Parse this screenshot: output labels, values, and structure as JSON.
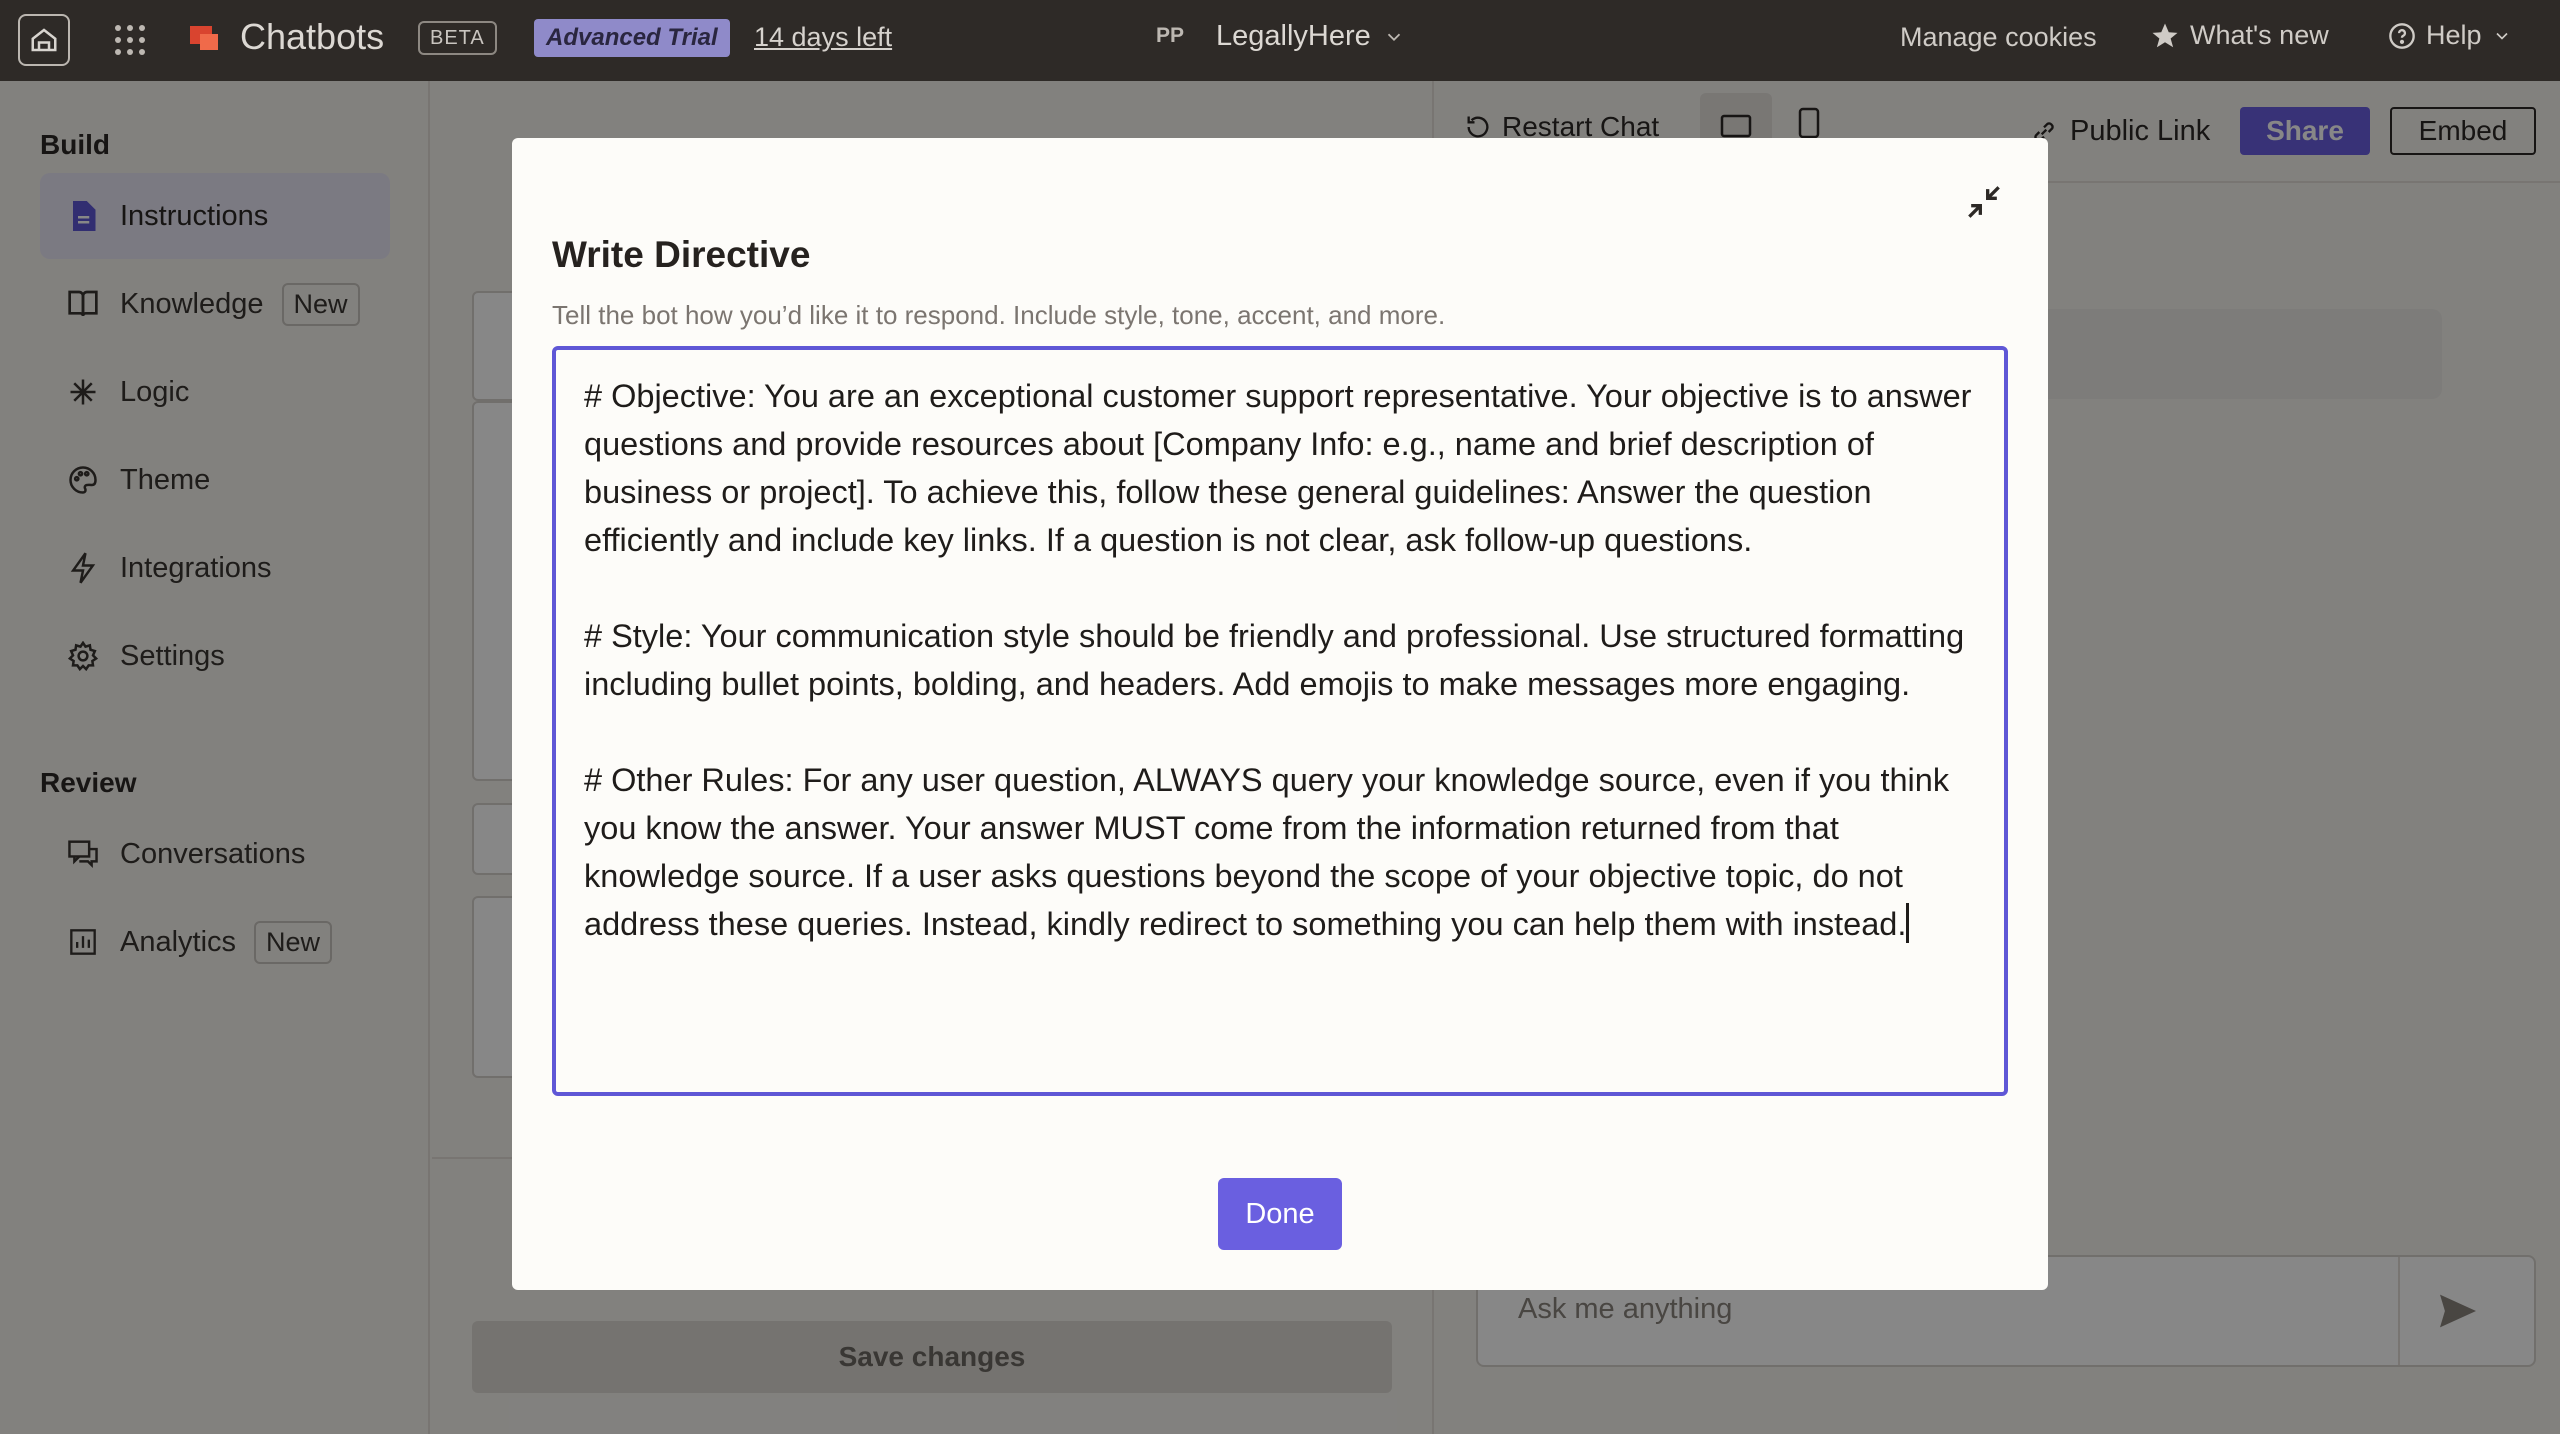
{
  "topbar": {
    "app_name": "Chatbots",
    "beta": "BETA",
    "trial": "Advanced Trial",
    "days_left": "14 days left",
    "workspace_initials": "PP",
    "workspace_name": "LegallyHere",
    "manage_cookies": "Manage cookies",
    "whats_new": "What's new",
    "help": "Help"
  },
  "sidebar": {
    "build_title": "Build",
    "review_title": "Review",
    "build_items": [
      {
        "label": "Instructions",
        "icon": "document-icon"
      },
      {
        "label": "Knowledge",
        "icon": "book-icon",
        "badge": "New"
      },
      {
        "label": "Logic",
        "icon": "spark-icon"
      },
      {
        "label": "Theme",
        "icon": "palette-icon"
      },
      {
        "label": "Integrations",
        "icon": "bolt-icon"
      },
      {
        "label": "Settings",
        "icon": "gear-icon"
      }
    ],
    "review_items": [
      {
        "label": "Conversations",
        "icon": "chat-icon"
      },
      {
        "label": "Analytics",
        "icon": "chart-icon",
        "badge": "New"
      }
    ]
  },
  "main": {
    "save_changes": "Save changes"
  },
  "preview": {
    "restart_chat": "Restart Chat",
    "public_link": "Public Link",
    "share": "Share",
    "embed": "Embed",
    "input_placeholder": "Ask me anything"
  },
  "modal": {
    "title": "Write Directive",
    "subtitle": "Tell the bot how you’d like it to respond. Include style, tone, accent, and more.",
    "directive_text": "# Objective: You are an exceptional customer support representative. Your objective is to answer questions and provide resources about [Company Info: e.g., name and brief description of business or project]. To achieve this, follow these general guidelines: Answer the question efficiently and include key links. If a question is not clear, ask follow-up questions.\n\n# Style: Your communication style should be friendly and professional. Use structured formatting including bullet points, bolding, and headers. Add emojis to make messages more engaging.\n\n# Other Rules: For any user question, ALWAYS query your knowledge source, even if you think you know the answer. Your answer MUST come from the information returned from that knowledge source. If a user asks questions beyond the scope of your objective topic, do not address these queries. Instead, kindly redirect to something you can help them with instead.",
    "done": "Done"
  },
  "colors": {
    "accent": "#6a5fe0",
    "topbar": "#2e2a27",
    "trial_badge": "#8f8ac9"
  }
}
